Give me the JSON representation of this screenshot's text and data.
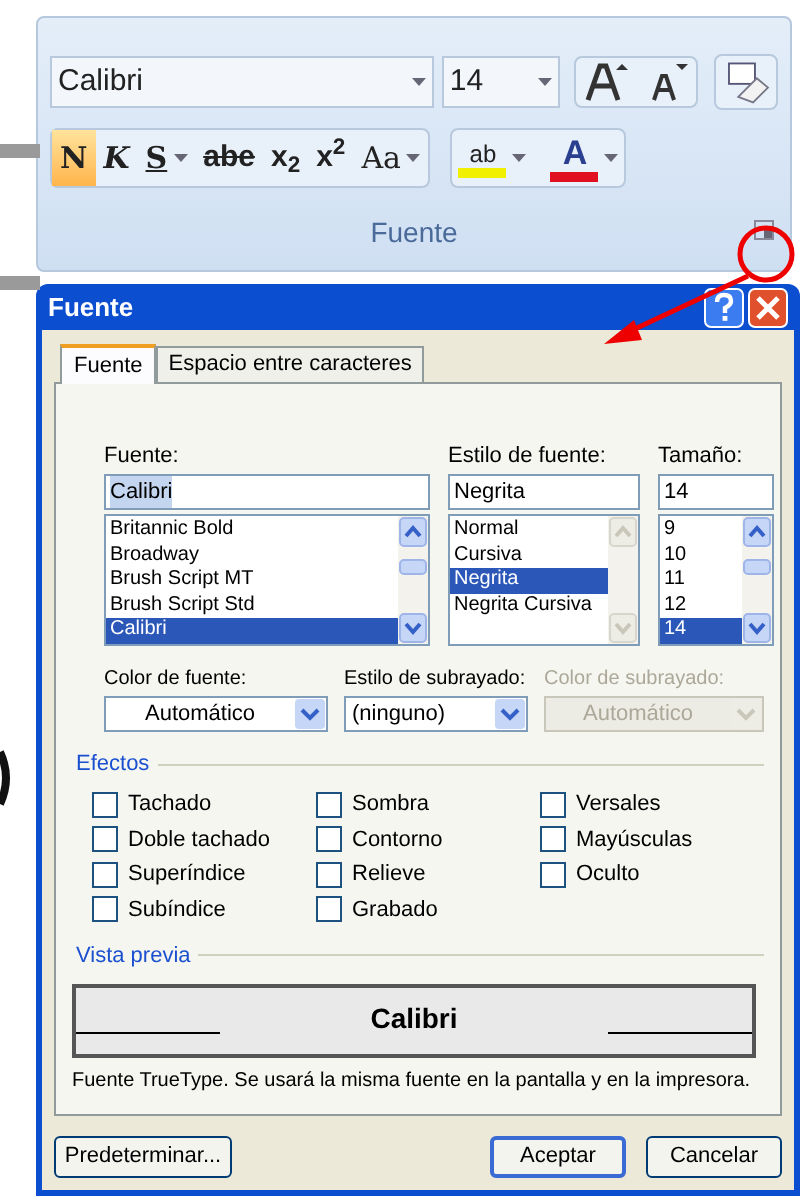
{
  "ribbon": {
    "font_name": "Calibri",
    "font_size": "14",
    "format_buttons": [
      {
        "label": "N",
        "kind": "bold",
        "selected": true,
        "dropdown": false
      },
      {
        "label": "K",
        "kind": "italic",
        "selected": false,
        "dropdown": false
      },
      {
        "label": "S",
        "kind": "underline",
        "selected": false,
        "dropdown": true
      },
      {
        "label": "abe",
        "kind": "strike",
        "selected": false,
        "dropdown": false
      },
      {
        "label": "x$_{2}$",
        "kind": "plain",
        "selected": false,
        "dropdown": false
      },
      {
        "label": "x$^{2}$",
        "kind": "plain",
        "selected": false,
        "dropdown": false
      },
      {
        "label": "Aa",
        "kind": "serif",
        "selected": false,
        "dropdown": true
      }
    ],
    "highlight": {
      "label": "ab",
      "color": "#f0f000"
    },
    "font_color": {
      "label": "A",
      "color": "#e01020"
    },
    "group_label": "Fuente"
  },
  "dialog": {
    "title": "Fuente",
    "tabs": [
      {
        "label": "Fuente",
        "selected": true
      },
      {
        "label": "Espacio entre caracteres",
        "selected": false
      }
    ],
    "font": {
      "label": "Fuente:",
      "value": "Calibri",
      "items": [
        {
          "text": "Britannic Bold",
          "selected": false
        },
        {
          "text": "Broadway",
          "selected": false
        },
        {
          "text": "Brush Script MT",
          "selected": false
        },
        {
          "text": "Brush Script Std",
          "selected": false
        },
        {
          "text": "Calibri",
          "selected": true
        }
      ]
    },
    "style": {
      "label": "Estilo de fuente:",
      "value": "Negrita",
      "items": [
        {
          "text": "Normal",
          "selected": false
        },
        {
          "text": "Cursiva",
          "selected": false
        },
        {
          "text": "Negrita",
          "selected": true
        },
        {
          "text": "Negrita Cursiva",
          "selected": false
        }
      ]
    },
    "size": {
      "label": "Tamaño:",
      "value": "14",
      "items": [
        {
          "text": "9",
          "selected": false
        },
        {
          "text": "10",
          "selected": false
        },
        {
          "text": "11",
          "selected": false
        },
        {
          "text": "12",
          "selected": false
        },
        {
          "text": "14",
          "selected": true
        }
      ]
    },
    "combos": [
      {
        "label": "Color de fuente:",
        "value": "Automático",
        "disabled": false,
        "centered": true
      },
      {
        "label": "Estilo de subrayado:",
        "value": "(ninguno)",
        "disabled": false,
        "centered": false
      },
      {
        "label": "Color de subrayado:",
        "value": "Automático",
        "disabled": true,
        "centered": true
      }
    ],
    "effects_title": "Efectos",
    "effects": [
      [
        {
          "label": "Tachado",
          "checked": false
        },
        {
          "label": "Doble tachado",
          "checked": false
        },
        {
          "label": "Superíndice",
          "checked": false
        },
        {
          "label": "Subíndice",
          "checked": false
        }
      ],
      [
        {
          "label": "Sombra",
          "checked": false
        },
        {
          "label": "Contorno",
          "checked": false
        },
        {
          "label": "Relieve",
          "checked": false
        },
        {
          "label": "Grabado",
          "checked": false
        }
      ],
      [
        {
          "label": "Versales",
          "checked": false
        },
        {
          "label": "Mayúsculas",
          "checked": false
        },
        {
          "label": "Oculto",
          "checked": false
        }
      ]
    ],
    "preview_title": "Vista previa",
    "preview_text": "Calibri",
    "note": "Fuente TrueType. Se usará la misma fuente en la pantalla y en la impresora.",
    "buttons": [
      {
        "label": "Predeterminar...",
        "default": false
      },
      {
        "label": "Aceptar",
        "default": true
      },
      {
        "label": "Cancelar",
        "default": false
      }
    ]
  }
}
